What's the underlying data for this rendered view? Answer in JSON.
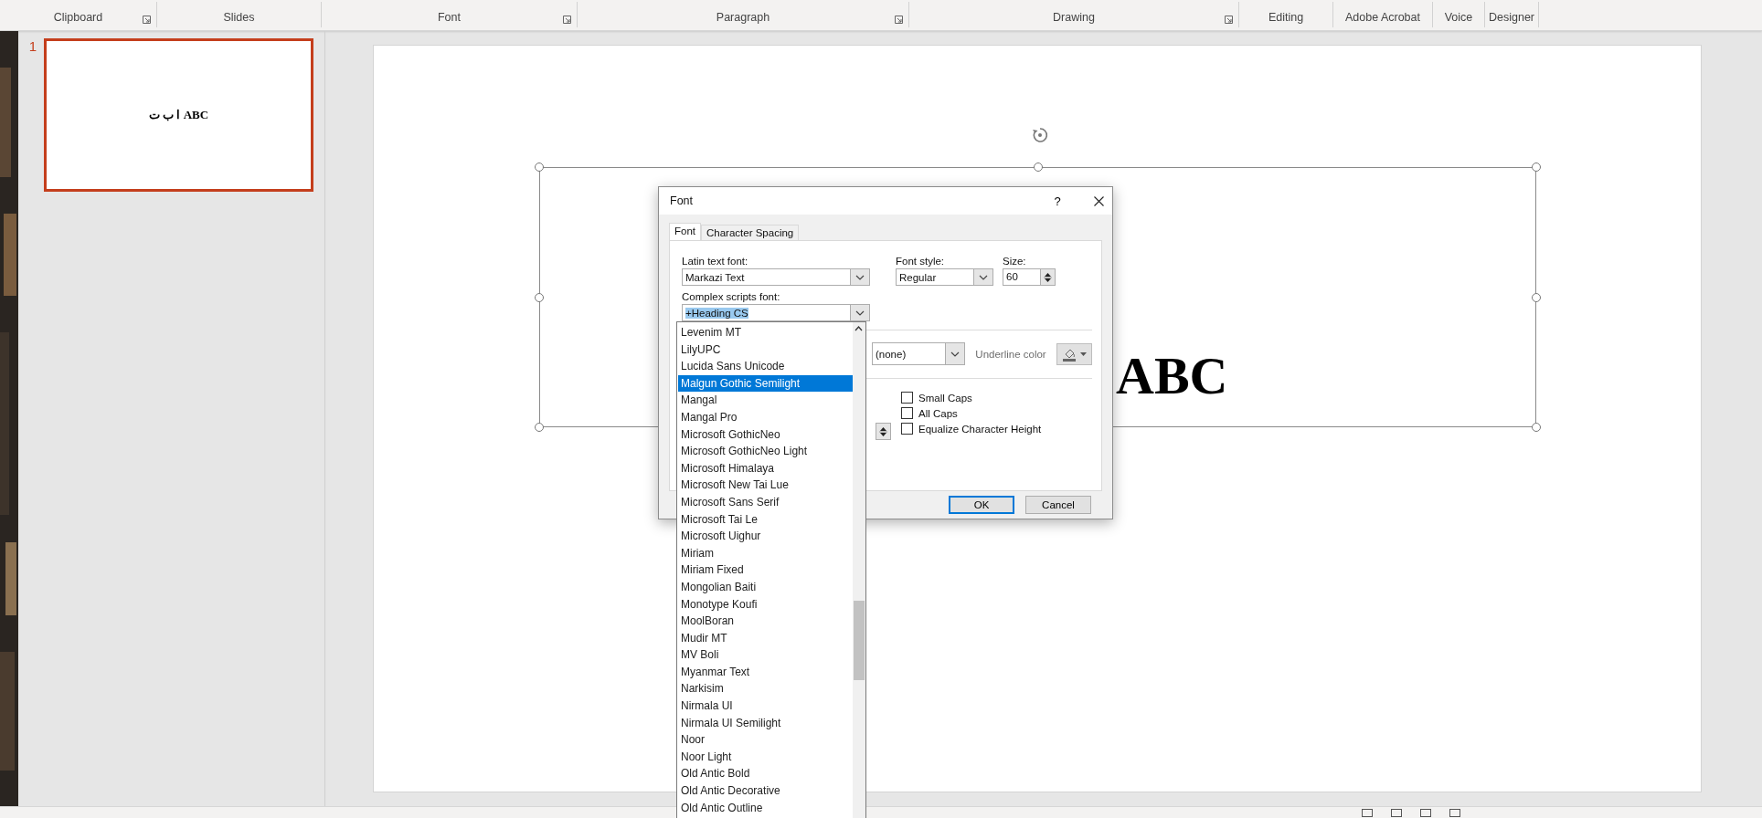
{
  "ribbon": {
    "groups": [
      {
        "label": "Clipboard",
        "launcher": true
      },
      {
        "label": "Slides",
        "launcher": false
      },
      {
        "label": "Font",
        "launcher": true
      },
      {
        "label": "Paragraph",
        "launcher": true
      },
      {
        "label": "Drawing",
        "launcher": true
      },
      {
        "label": "Editing",
        "launcher": false
      },
      {
        "label": "Adobe Acrobat",
        "launcher": false
      },
      {
        "label": "Voice",
        "launcher": false
      },
      {
        "label": "Designer",
        "launcher": false
      }
    ]
  },
  "slides_pane": {
    "thumbnails": [
      {
        "number": "1",
        "text": "ا ب ت ABC",
        "selected": true
      }
    ]
  },
  "slide": {
    "text": "ABC"
  },
  "dialog": {
    "title": "Font",
    "help": "?",
    "tabs": [
      {
        "label": "Font",
        "selected": true
      },
      {
        "label": "Character Spacing",
        "selected": false
      }
    ],
    "latin_text_font": {
      "label": "Latin text font:",
      "value": "Markazi Text"
    },
    "font_style": {
      "label": "Font style:",
      "value": "Regular"
    },
    "size": {
      "label": "Size:",
      "value": "60"
    },
    "complex_scripts_font": {
      "label": "Complex scripts font:",
      "value": "+Heading CS",
      "expanded": true,
      "options": [
        {
          "label": "Levenim MT",
          "selected": false
        },
        {
          "label": "LilyUPC",
          "selected": false
        },
        {
          "label": "Lucida Sans Unicode",
          "selected": false
        },
        {
          "label": "Malgun Gothic Semilight",
          "selected": true
        },
        {
          "label": "Mangal",
          "selected": false
        },
        {
          "label": "Mangal Pro",
          "selected": false
        },
        {
          "label": "Microsoft GothicNeo",
          "selected": false
        },
        {
          "label": "Microsoft GothicNeo Light",
          "selected": false
        },
        {
          "label": "Microsoft Himalaya",
          "selected": false
        },
        {
          "label": "Microsoft New Tai Lue",
          "selected": false
        },
        {
          "label": "Microsoft Sans Serif",
          "selected": false
        },
        {
          "label": "Microsoft Tai Le",
          "selected": false
        },
        {
          "label": "Microsoft Uighur",
          "selected": false
        },
        {
          "label": "Miriam",
          "selected": false
        },
        {
          "label": "Miriam Fixed",
          "selected": false
        },
        {
          "label": "Mongolian Baiti",
          "selected": false
        },
        {
          "label": "Monotype Koufi",
          "selected": false
        },
        {
          "label": "MoolBoran",
          "selected": false
        },
        {
          "label": "Mudir MT",
          "selected": false
        },
        {
          "label": "MV Boli",
          "selected": false
        },
        {
          "label": "Myanmar Text",
          "selected": false
        },
        {
          "label": "Narkisim",
          "selected": false
        },
        {
          "label": "Nirmala UI",
          "selected": false
        },
        {
          "label": "Nirmala UI Semilight",
          "selected": false
        },
        {
          "label": "Noor",
          "selected": false
        },
        {
          "label": "Noor Light",
          "selected": false
        },
        {
          "label": "Old Antic Bold",
          "selected": false
        },
        {
          "label": "Old Antic Decorative",
          "selected": false
        },
        {
          "label": "Old Antic Outline",
          "selected": false
        }
      ]
    },
    "underline_style": {
      "value": "(none)"
    },
    "underline_color": {
      "label": "Underline color"
    },
    "effects": [
      {
        "label": "Small Caps",
        "checked": false
      },
      {
        "label": "All Caps",
        "checked": false
      },
      {
        "label": "Equalize Character Height",
        "checked": false
      }
    ],
    "buttons": [
      {
        "label": "OK",
        "default": true
      },
      {
        "label": "Cancel",
        "default": false
      }
    ]
  }
}
